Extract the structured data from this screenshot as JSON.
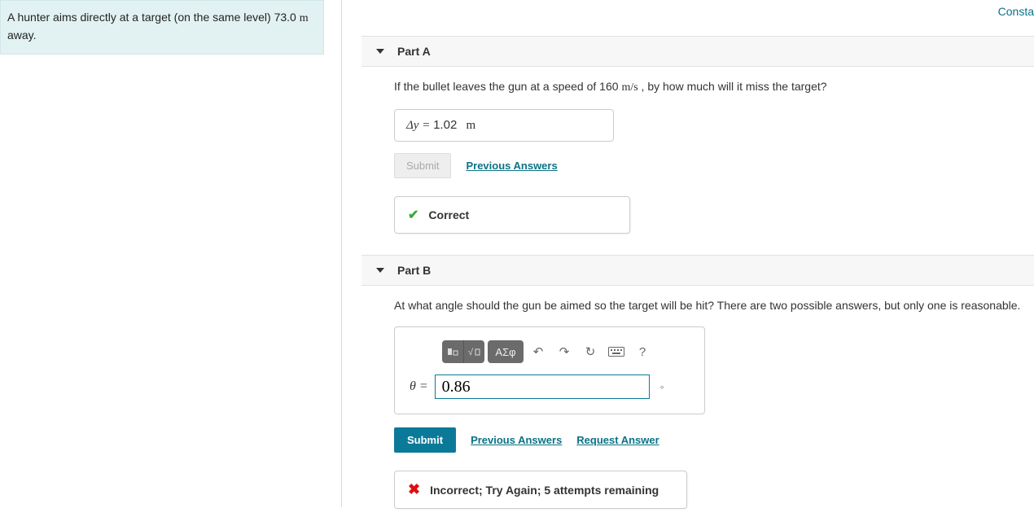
{
  "top_link": "Consta",
  "problem_text_a": "A hunter aims directly at a target (on the same level) 73.0 ",
  "problem_unit": "m",
  "problem_text_b": " away.",
  "partA": {
    "title": "Part A",
    "question_pre": "If the bullet leaves the gun at a speed of 160 ",
    "question_unit": "m/s",
    "question_post": " , by how much will it miss the target?",
    "answer_label": "Δy = ",
    "answer_value": "1.02",
    "answer_unit": "m",
    "submit": "Submit",
    "prev": "Previous Answers",
    "feedback": "Correct"
  },
  "partB": {
    "title": "Part B",
    "question": "At what angle should the gun be aimed so the target will be hit? There are two possible answers, but only one is reasonable.",
    "toolbar_symbols": "ΑΣφ",
    "theta_label": "θ = ",
    "input_value": "0.86",
    "unit": "∘",
    "submit": "Submit",
    "prev": "Previous Answers",
    "request": "Request Answer",
    "feedback": "Incorrect; Try Again; 5 attempts remaining"
  }
}
